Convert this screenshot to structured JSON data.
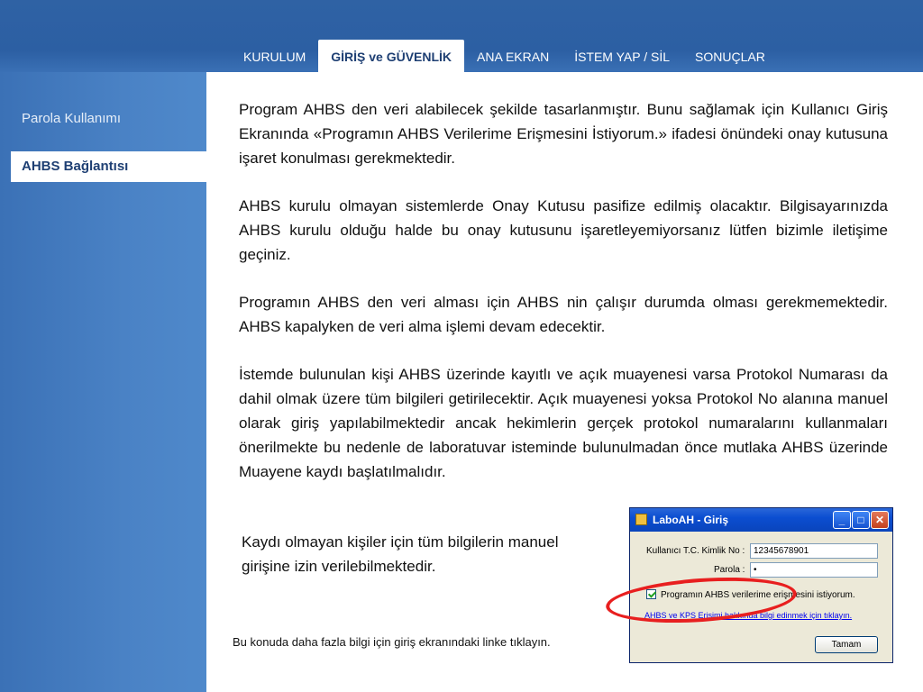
{
  "tabs": [
    {
      "label": "KURULUM"
    },
    {
      "label": "GİRİŞ ve GÜVENLİK"
    },
    {
      "label": "ANA EKRAN"
    },
    {
      "label": "İSTEM YAP / SİL"
    },
    {
      "label": "SONUÇLAR"
    }
  ],
  "active_tab": "GİRİŞ ve GÜVENLİK",
  "sidebar": {
    "items": [
      {
        "label": "Parola Kullanımı"
      },
      {
        "label": "AHBS Bağlantısı"
      }
    ],
    "active_item": "AHBS Bağlantısı"
  },
  "content": {
    "paragraphs": [
      "Program AHBS den veri alabilecek şekilde tasarlanmıştır. Bunu sağlamak için Kullanıcı Giriş Ekranında «Programın AHBS Verilerime Erişmesini İstiyorum.» ifadesi önündeki onay kutusuna işaret konulması gerekmektedir.",
      " AHBS kurulu olmayan sistemlerde Onay Kutusu pasifize edilmiş olacaktır. Bilgisayarınızda AHBS kurulu olduğu halde bu onay kutusunu işaretleyemiyorsanız lütfen bizimle iletişime geçiniz.",
      "Programın AHBS den veri alması için AHBS nin çalışır durumda olması gerekmemektedir. AHBS kapalyken de veri alma işlemi devam edecektir.",
      "İstemde bulunulan kişi AHBS üzerinde kayıtlı ve açık muayenesi varsa Protokol Numarası da dahil olmak üzere tüm bilgileri getirilecektir. Açık muayenesi yoksa Protokol No alanına manuel olarak giriş yapılabilmektedir ancak hekimlerin gerçek protokol numaralarını kullanmaları önerilmekte bu nedenle de laboratuvar isteminde bulunulmadan önce mutlaka AHBS üzerinde Muayene kaydı başlatılmalıdır."
    ],
    "note": "Kaydı olmayan kişiler için tüm bilgilerin manuel girişine izin verilebilmektedir.",
    "footer_note": "Bu konuda daha fazla bilgi için giriş ekranındaki linke tıklayın."
  },
  "dialog": {
    "title": "LaboAH - Giriş",
    "kimlik_label": "Kullanıcı T.C. Kimlik No :",
    "kimlik_value": "12345678901",
    "parola_label": "Parola :",
    "parola_value": "•",
    "checkbox_label": "Programın AHBS verilerime erişmesini istiyorum.",
    "checkbox_checked": true,
    "link_text": "AHBS ve KPS Erişimi hakkında bilgi edinmek için tıklayın.",
    "ok_label": "Tamam",
    "minimize_glyph": "_",
    "maximize_glyph": "□",
    "close_glyph": "✕"
  },
  "colors": {
    "header_blue": "#2c5fa3",
    "sidebar_blue": "#4a82c5",
    "active_text": "#1e3f73",
    "highlight_red": "#e81f1f"
  }
}
